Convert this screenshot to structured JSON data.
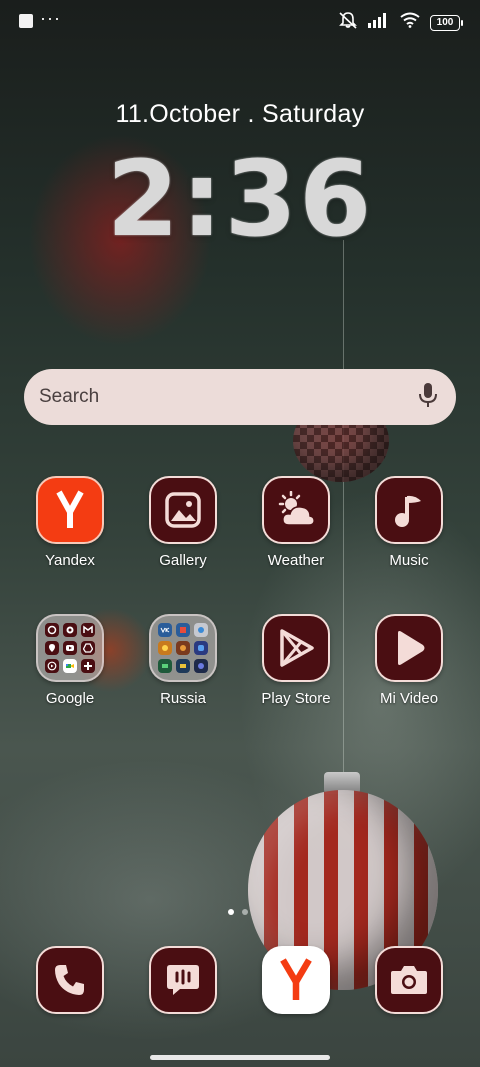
{
  "status_bar": {
    "more_indicator": "···",
    "battery_level": "100"
  },
  "clock": {
    "date": "11.October . Saturday",
    "time": "2:36"
  },
  "search": {
    "placeholder": "Search"
  },
  "apps_row1": [
    {
      "label": "Yandex",
      "icon": "yandex-icon"
    },
    {
      "label": "Gallery",
      "icon": "gallery-icon"
    },
    {
      "label": "Weather",
      "icon": "weather-icon"
    },
    {
      "label": "Music",
      "icon": "music-icon"
    }
  ],
  "apps_row2": [
    {
      "label": "Google",
      "icon": "folder-icon"
    },
    {
      "label": "Russia",
      "icon": "folder-icon"
    },
    {
      "label": "Play Store",
      "icon": "play-store-icon"
    },
    {
      "label": "Mi Video",
      "icon": "mi-video-icon"
    }
  ],
  "dock": [
    {
      "icon": "phone-icon"
    },
    {
      "icon": "messages-icon"
    },
    {
      "icon": "yandex-browser-icon"
    },
    {
      "icon": "camera-icon"
    }
  ],
  "page_indicator": {
    "pages": 2,
    "current": 1
  },
  "colors": {
    "icon_bg": "#4a0e12",
    "icon_border": "#f4dcd8",
    "yandex_red": "#f43c12",
    "search_bg": "#ecdcd9"
  }
}
